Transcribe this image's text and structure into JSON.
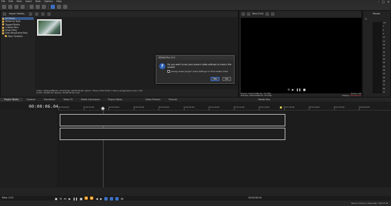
{
  "menu": [
    "File",
    "Edit",
    "View",
    "Insert",
    "Tools",
    "Options",
    "Help"
  ],
  "window_controls": [
    "–",
    "□",
    "✕"
  ],
  "explorer": {
    "header_label": "Import Media…",
    "tree": [
      {
        "label": "All Media",
        "indent": 0,
        "selected": true
      },
      {
        "label": "Media by Type",
        "indent": 0
      },
      {
        "label": "Tagged Media",
        "indent": 0
      },
      {
        "label": "Custom Bins",
        "indent": 0
      },
      {
        "label": "Smart Bins",
        "indent": 0
      },
      {
        "label": "Shot Bins/Scene Bins",
        "indent": 0
      },
      {
        "label": "Main Timeline",
        "indent": 1
      }
    ],
    "info_line1": "Video: 1920x1080x32, 23.976 fps, 00:00:05;00, Alpha = None, Field Order = None (progressive scan), AVC",
    "info_line2": "Audio: 48,000 Hz, Stereo, 00:00:05;00, AAC"
  },
  "bottom_tabs": [
    "Project Media",
    "Explorer",
    "Transitions",
    "Video FX",
    "Media Generators",
    "Project Notes"
  ],
  "preview": {
    "label": "Best (Full)",
    "tabs": [
      "Video Preview",
      "Trimmer"
    ],
    "project_label": "Project:",
    "project_value": "1920x1080x32, 23.976p",
    "preview_label": "Preview:",
    "preview_value": "1920x1080x32, 23.976p",
    "frame_label": "Frame:",
    "frame_value": "145",
    "display_label": "Display:",
    "display_value": "364x206x32"
  },
  "master": {
    "label": "Master",
    "tab": "Master Bus",
    "scale": [
      "-Inf",
      "3",
      "6",
      "9",
      "12",
      "15",
      "18",
      "21",
      "24",
      "27",
      "30",
      "33",
      "36",
      "39",
      "42",
      "45",
      "48",
      "51",
      "54",
      "57"
    ]
  },
  "timeline": {
    "timecode": "00:00:06.04",
    "ruler_labels": [
      "00:00:00;00",
      "00:00:10;00",
      "00:00:20;00",
      "00:00:30;00",
      "00:00:40;00",
      "00:00:50;00",
      "00:01:00;00",
      "00:01:10;00",
      "00:01:20;00",
      "00:01:30;00",
      "00:01:40;00",
      "00:01:50;00",
      "00:02:00;00"
    ],
    "rate_label": "Rate: 0.00",
    "bottom_timecode": "00:00:06.04"
  },
  "status": "Record Time (2 channels): 339:17:05",
  "dialog": {
    "title": "VEGAS Pro 17.0",
    "message": "Do you want to set your project video settings to match this media?",
    "checkbox_label": "Always base project video settings on first added video",
    "yes_label": "Yes",
    "no_label": "No"
  }
}
